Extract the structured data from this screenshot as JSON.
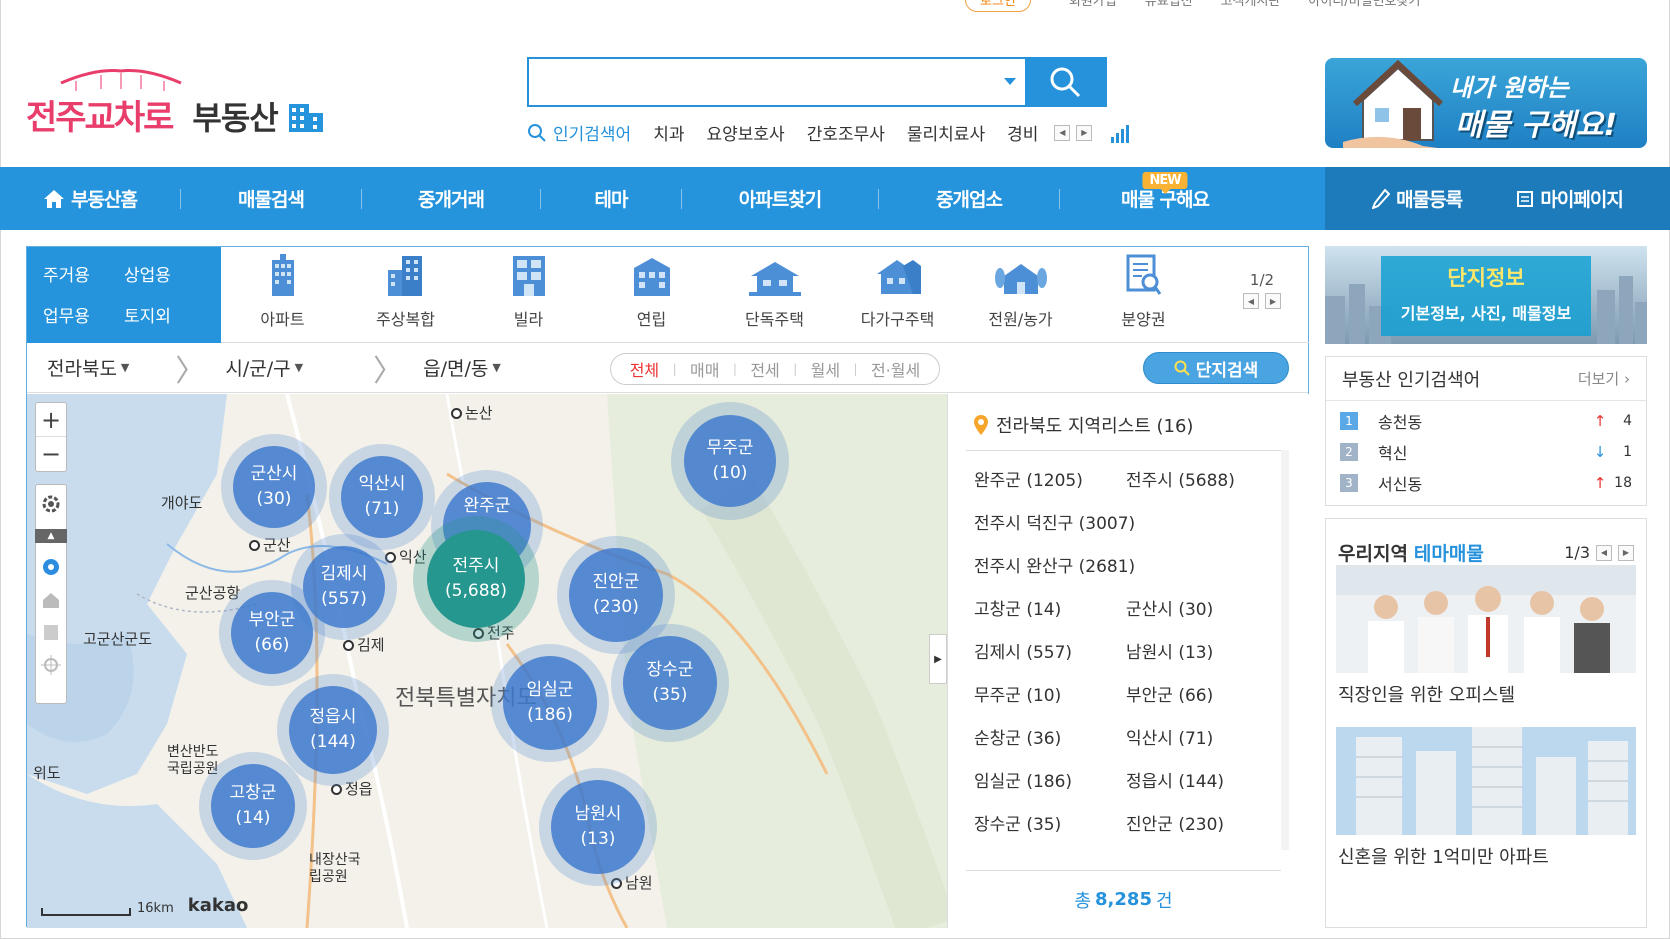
{
  "util": [
    "로그인",
    "회원가입",
    "유료입전",
    "고객게시판",
    "아이디/비밀번호찾기"
  ],
  "logo": {
    "brand": "전주교차로",
    "sub": "부동산"
  },
  "search": {
    "placeholder": "",
    "popular_label": "인기검색어",
    "keywords": [
      "치과",
      "요양보호사",
      "간호조무사",
      "물리치료사",
      "경비"
    ]
  },
  "banner": {
    "line1": "내가 원하는",
    "line2": "매물 구해요!"
  },
  "nav": {
    "items": [
      "부동산홈",
      "매물검색",
      "중개거래",
      "테마",
      "아파트찾기",
      "중개업소",
      "매물 구해요"
    ],
    "new_badge": "NEW",
    "register": "매물등록",
    "mypage": "마이페이지"
  },
  "cats": [
    "주거용",
    "상업용",
    "업무용",
    "토지외"
  ],
  "types": [
    "아파트",
    "주상복합",
    "빌라",
    "연립",
    "단독주택",
    "다가구주택",
    "전원/농가",
    "분양권"
  ],
  "types_page": "1/2",
  "filter": {
    "province": "전라북도",
    "city": "시/군/구",
    "town": "읍/면/동",
    "deal": [
      "전체",
      "매매",
      "전세",
      "월세",
      "전·월세"
    ],
    "search_btn": "단지검색"
  },
  "map": {
    "clusters": [
      {
        "name": "군산시",
        "count": "(30)"
      },
      {
        "name": "익산시",
        "count": "(71)"
      },
      {
        "name": "완주군",
        "count": ""
      },
      {
        "name": "무주군",
        "count": "(10)"
      },
      {
        "name": "김제시",
        "count": "(557)"
      },
      {
        "name": "전주시",
        "count": "(5,688)"
      },
      {
        "name": "진안군",
        "count": "(230)"
      },
      {
        "name": "부안군",
        "count": "(66)"
      },
      {
        "name": "장수군",
        "count": "(35)"
      },
      {
        "name": "임실군",
        "count": "(186)"
      },
      {
        "name": "정읍시",
        "count": "(144)"
      },
      {
        "name": "고창군",
        "count": "(14)"
      },
      {
        "name": "남원시",
        "count": "(13)"
      }
    ],
    "places": [
      "논산",
      "군산",
      "익산",
      "김제",
      "전주",
      "정읍",
      "남원",
      "개야도",
      "군산공항",
      "고군산군도",
      "위도",
      "변산반도국립공원",
      "내장산국립공원",
      "전북특별자치도"
    ],
    "scale": "16km",
    "brand": "kakao"
  },
  "regions": {
    "title": "전라북도 지역리스트 (16)",
    "items": [
      "완주군 (1205)",
      "전주시 (5688)",
      "전주시 덕진구 (3007)",
      "전주시 완산구 (2681)",
      "고창군 (14)",
      "군산시 (30)",
      "김제시 (557)",
      "남원시 (13)",
      "무주군 (10)",
      "부안군 (66)",
      "순창군 (36)",
      "익산시 (71)",
      "임실군 (186)",
      "정읍시 (144)",
      "장수군 (35)",
      "진안군 (230)"
    ],
    "total_prefix": "총",
    "total": "8,285",
    "total_suffix": "건"
  },
  "rbanner": {
    "title": "단지정보",
    "sub": "기본정보, 사진, 매물정보"
  },
  "ranking": {
    "title": "부동산 인기검색어",
    "more": "더보기",
    "rows": [
      {
        "n": "1",
        "kw": "송천동",
        "dir": "↑",
        "cnt": "4"
      },
      {
        "n": "2",
        "kw": "혁신",
        "dir": "↓",
        "cnt": "1"
      },
      {
        "n": "3",
        "kw": "서신동",
        "dir": "↑",
        "cnt": "18"
      }
    ]
  },
  "theme": {
    "title": "우리지역",
    "accent": "테마매물",
    "page": "1/3",
    "cards": [
      "직장인을 위한 오피스텔",
      "신혼을 위한 1억미만 아파트"
    ]
  }
}
